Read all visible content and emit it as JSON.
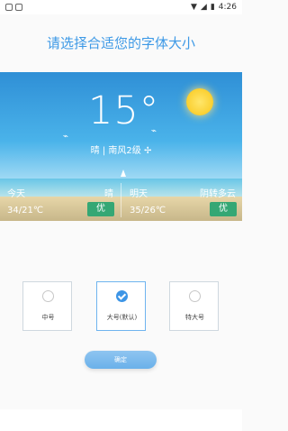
{
  "status_bar": {
    "time": "4:26",
    "left_icons": [
      "settings-icon",
      "notification-icon"
    ],
    "right_icons": [
      "wifi-icon",
      "signal-icon",
      "battery-icon"
    ]
  },
  "page": {
    "title": "请选择合适您的字体大小"
  },
  "weather_preview": {
    "temperature": "15°",
    "condition": "晴",
    "wind": "南风2级",
    "today": {
      "label": "今天",
      "condition": "晴",
      "temp_range": "34/21℃",
      "aqi_badge": "优"
    },
    "tomorrow": {
      "label": "明天",
      "condition": "阴转多云",
      "temp_range": "35/26℃",
      "aqi_badge": "优"
    }
  },
  "font_options": [
    {
      "label": "中号",
      "selected": false
    },
    {
      "label": "大号(默认)",
      "selected": true
    },
    {
      "label": "特大号",
      "selected": false
    }
  ],
  "confirm_button": {
    "label": "确定"
  },
  "colors": {
    "title": "#3d99e6",
    "button": "#6ab1ea",
    "badge": "#35a774",
    "radio_selected": "#3d95e6"
  }
}
